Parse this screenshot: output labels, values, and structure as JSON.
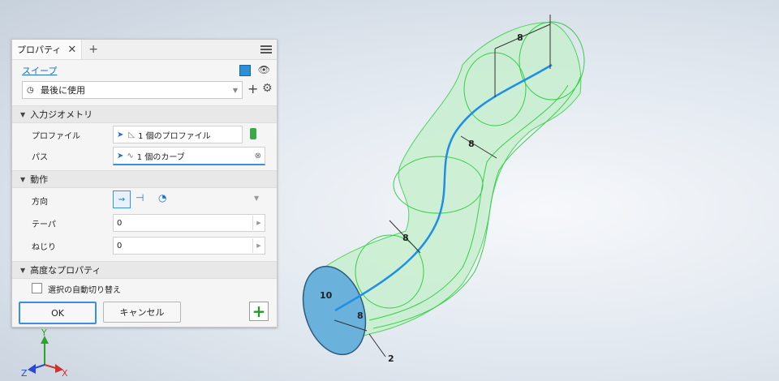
{
  "panel": {
    "tab_label": "プロパティ",
    "command_link": "スイープ",
    "preset": "最後に使用",
    "sections": {
      "input_geometry": "入力ジオメトリ",
      "behavior": "動作",
      "advanced": "高度なプロパティ"
    },
    "profile_label": "プロファイル",
    "profile_value": "1 個のプロファイル",
    "path_label": "パス",
    "path_value": "1 個のカーブ",
    "direction_label": "方向",
    "taper_label": "テーパ",
    "taper_value": "0",
    "twist_label": "ねじり",
    "twist_value": "0",
    "auto_switch_label": "選択の自動切り替え",
    "ok_label": "OK",
    "cancel_label": "キャンセル"
  },
  "dimensions": {
    "d1": "8",
    "d2": "8",
    "d3": "8",
    "d4": "10",
    "d5": "8",
    "d6": "2"
  },
  "axes": {
    "y": "Y",
    "x": "X",
    "z": "Z"
  },
  "colors": {
    "accent": "#1e6fd0",
    "path": "#1e8ee6",
    "body": "#b7ecc0",
    "edge": "#3bd04b",
    "profile": "#6ab2dc"
  }
}
